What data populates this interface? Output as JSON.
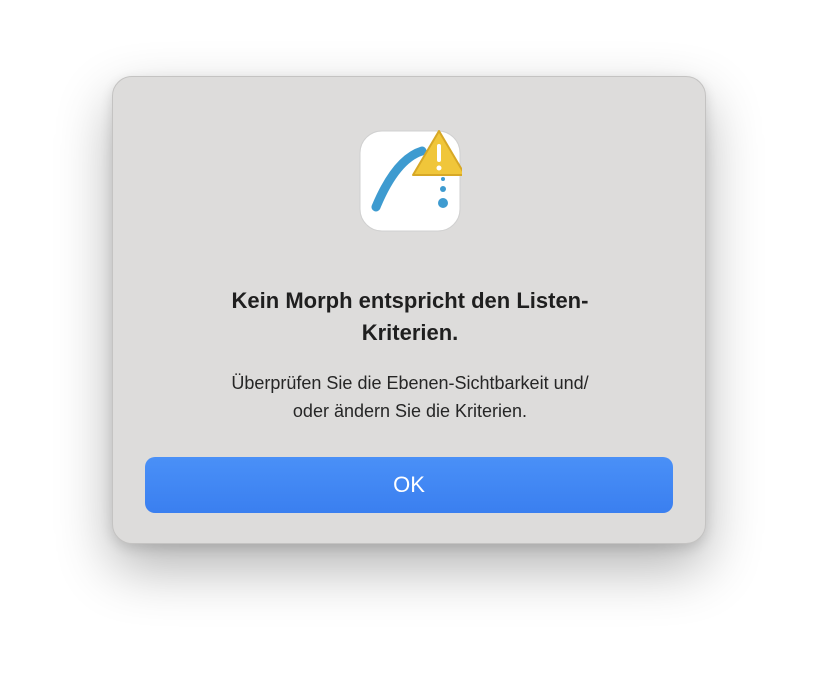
{
  "dialog": {
    "title_lines": [
      "Kein Morph entspricht den Listen-",
      "Kriterien."
    ],
    "message_lines": [
      "Überprüfen Sie die Ebenen-Sichtbarkeit und/",
      "oder ändern Sie die Kriterien."
    ],
    "ok_label": "OK",
    "app_icon": "morph-curve-icon",
    "warning_icon": "warning-triangle-icon"
  },
  "colors": {
    "dialog_background": "#dddcdb",
    "button_blue": "#3d83f3",
    "curve_blue": "#3e9bd0",
    "warning_yellow": "#f0c63a"
  }
}
